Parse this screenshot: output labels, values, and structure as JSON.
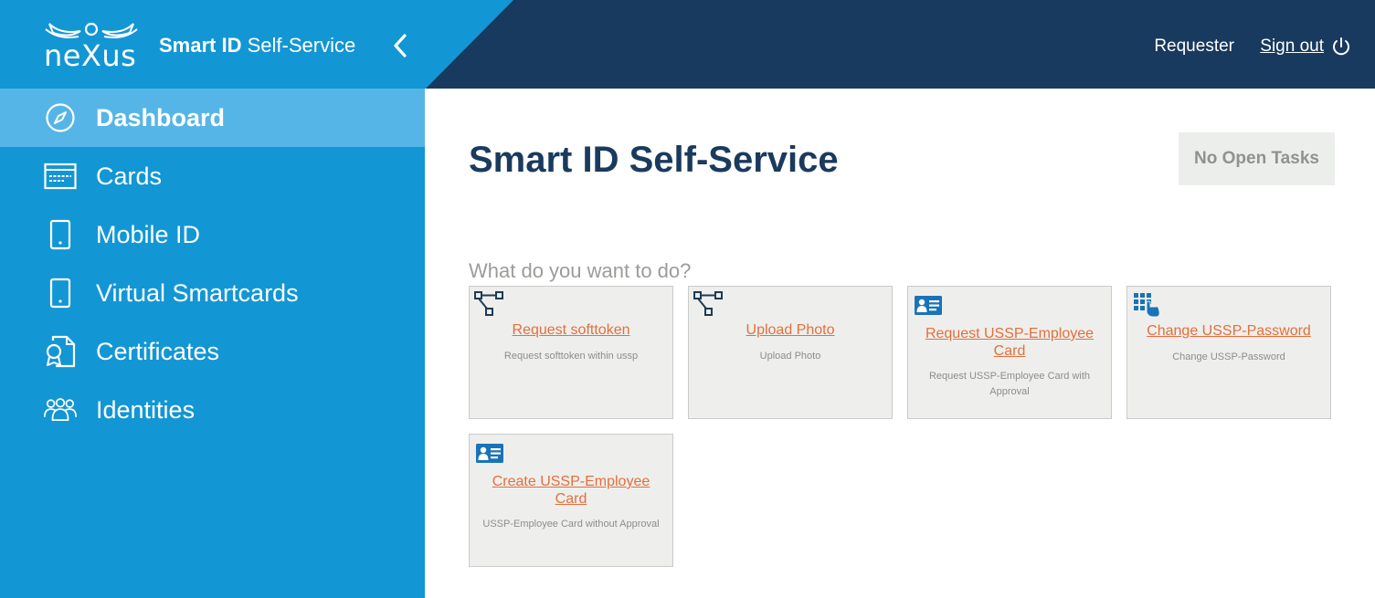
{
  "header": {
    "logo_text": "neXus",
    "brand_bold": "Smart ID",
    "brand_rest": " Self-Service",
    "user_role": "Requester",
    "sign_out": "Sign out"
  },
  "sidebar": {
    "items": [
      {
        "label": "Dashboard",
        "icon": "compass-icon",
        "active": true
      },
      {
        "label": "Cards",
        "icon": "card-icon"
      },
      {
        "label": "Mobile ID",
        "icon": "mobile-icon"
      },
      {
        "label": "Virtual Smartcards",
        "icon": "mobile-icon"
      },
      {
        "label": "Certificates",
        "icon": "certificate-icon"
      },
      {
        "label": "Identities",
        "icon": "people-icon"
      }
    ]
  },
  "main": {
    "title": "Smart ID Self-Service",
    "tasks_button": "No Open Tasks",
    "question": "What do you want to do?",
    "tiles": [
      {
        "title": "Request softtoken",
        "desc": "Request softtoken within ussp",
        "icon": "workflow-icon"
      },
      {
        "title": "Upload Photo",
        "desc": "Upload Photo",
        "icon": "workflow-icon"
      },
      {
        "title": "Request USSP-Employee Card",
        "desc": "Request USSP-Employee Card with Approval",
        "icon": "id-card-icon"
      },
      {
        "title": "Change USSP-Password",
        "desc": "Change USSP-Password",
        "icon": "keypad-icon"
      },
      {
        "title": "Create USSP-Employee Card",
        "desc": "USSP-Employee Card without Approval",
        "icon": "id-card-icon"
      }
    ]
  },
  "colors": {
    "header_dark": "#183a5e",
    "sidebar_blue": "#1396d4",
    "active_blue": "#55b5e7",
    "link_orange": "#e66e3c"
  }
}
